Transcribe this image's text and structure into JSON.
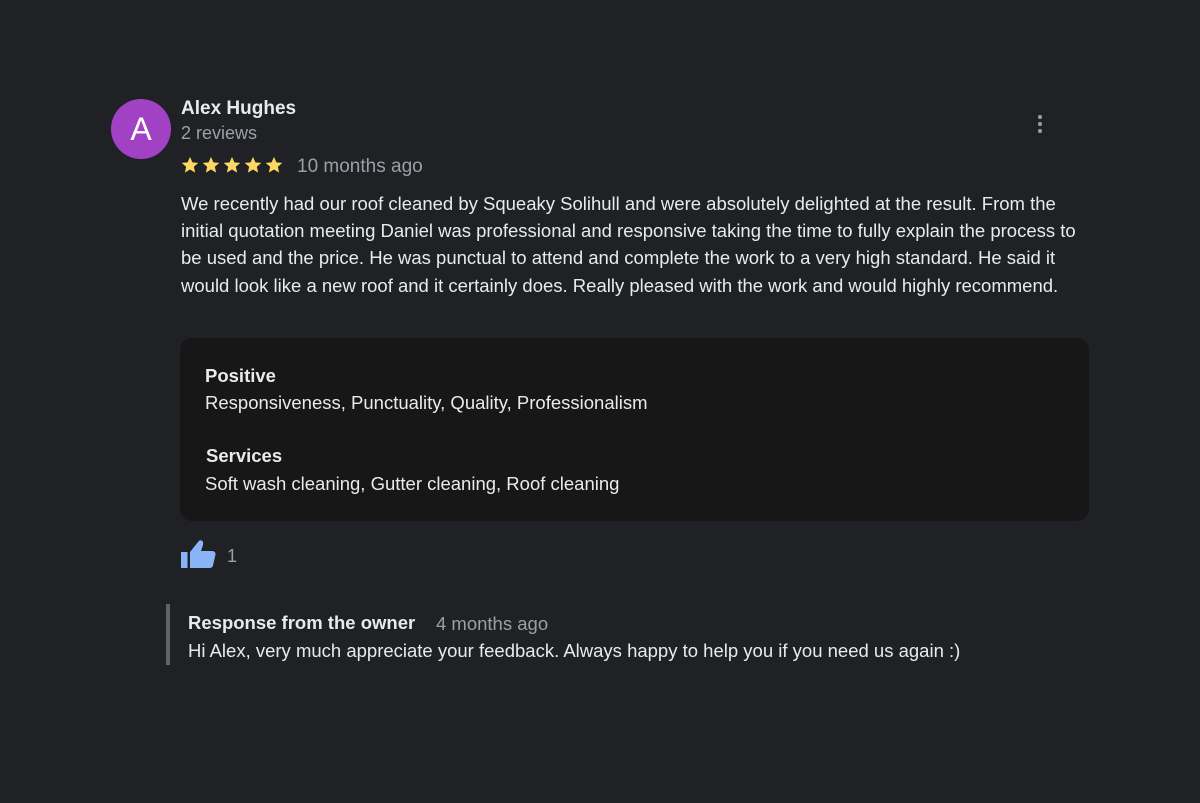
{
  "review": {
    "avatar_letter": "A",
    "avatar_color": "#a142c4",
    "reviewer_name": "Alex Hughes",
    "review_count": "2 reviews",
    "rating": 5,
    "rating_max": 5,
    "star_color": "#fdd663",
    "date": "10 months ago",
    "text": "We recently had our roof cleaned by Squeaky Solihull and were absolutely delighted at the result. From the initial quotation meeting Daniel was professional and responsive taking the time to fully explain the process to be used and the price. He was punctual to attend and complete the work to a very high standard. He said it would look like a new roof and it certainly does. Really pleased with the work and would highly recommend.",
    "more_icon": "more-vert-icon"
  },
  "attributes": {
    "positive_heading": "Positive",
    "positive_value": "Responsiveness, Punctuality, Quality, Professionalism",
    "services_heading": "Services",
    "services_value": "Soft wash cleaning, Gutter cleaning, Roof cleaning"
  },
  "like": {
    "icon": "thumbs-up-icon",
    "color": "#8ab4f8",
    "count": "1"
  },
  "owner_response": {
    "title": "Response from the owner",
    "date": "4 months ago",
    "text": "Hi Alex, very much appreciate your feedback. Always happy to help you if you need us again :)"
  }
}
